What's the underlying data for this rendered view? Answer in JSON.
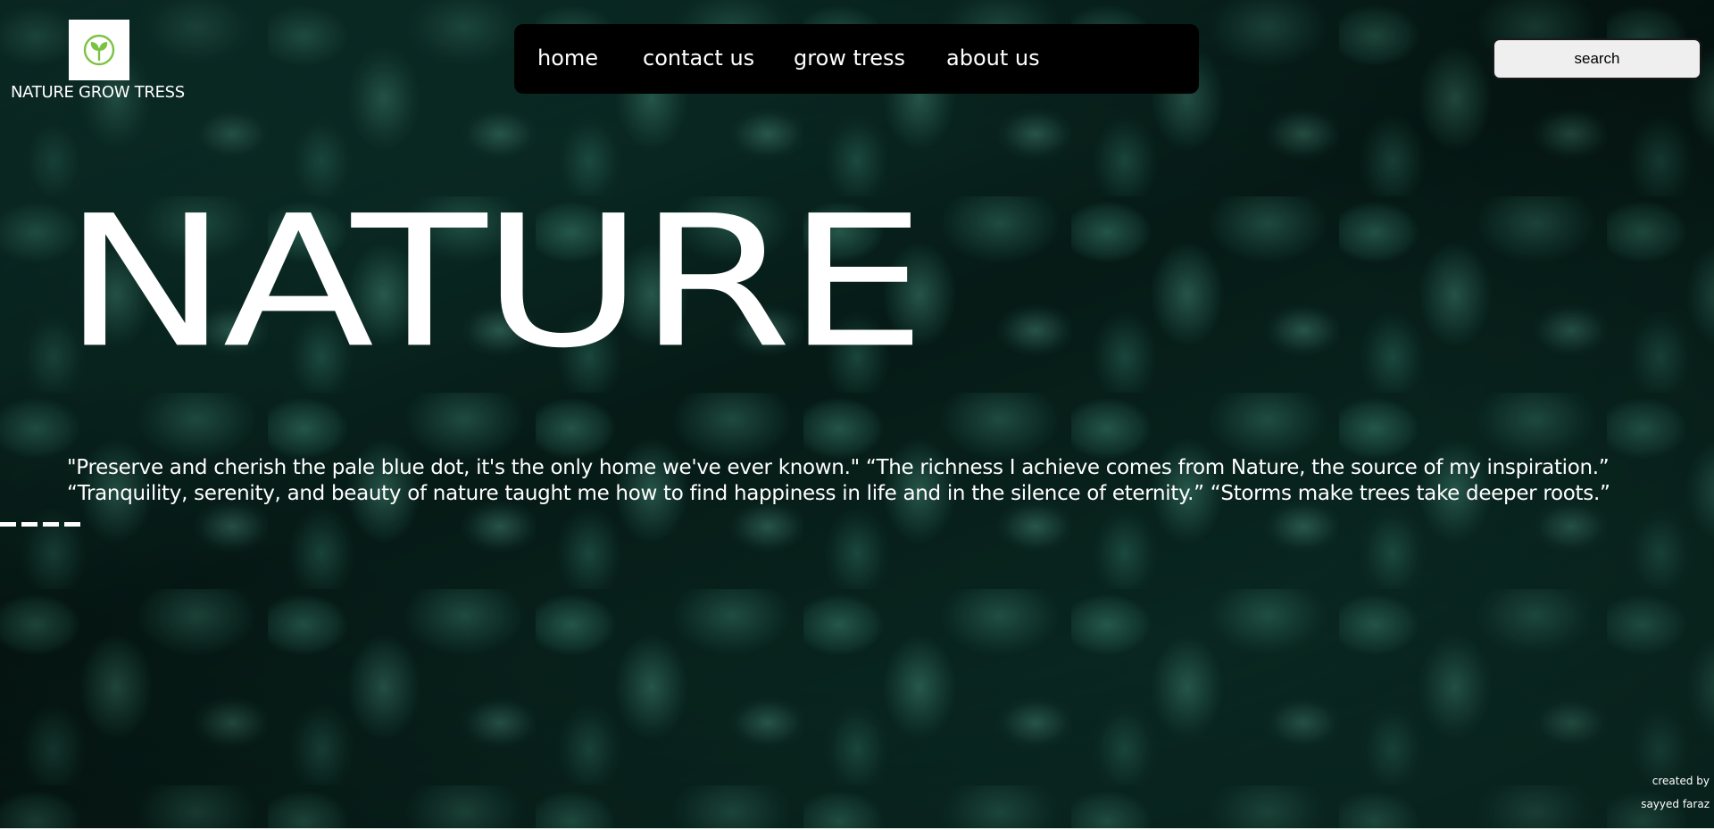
{
  "brand": {
    "name": "NATURE GROW TRESS",
    "logo_icon": "sprout-icon",
    "logo_color": "#7cc242"
  },
  "nav": {
    "items": [
      {
        "label": "home"
      },
      {
        "label": "contact us"
      },
      {
        "label": "grow tress"
      },
      {
        "label": "about us"
      }
    ]
  },
  "search": {
    "label": "search"
  },
  "hero": {
    "title": "NATURE",
    "quotes": [
      "\"Preserve and cherish the pale blue dot, it's the only home we've ever known.\" “The richness I achieve comes from Nature, the source of my inspiration.”",
      "“Tranquility, serenity, and beauty of nature taught me how to find happiness in life and in the silence of eternity.” “Storms make trees take deeper roots.”"
    ]
  },
  "footer": {
    "credit_line1": "created by",
    "credit_line2": "sayyed faraz"
  },
  "colors": {
    "background": "#0a2a24",
    "navbar": "#000000",
    "text": "#ffffff",
    "search_bg": "#efefef"
  }
}
